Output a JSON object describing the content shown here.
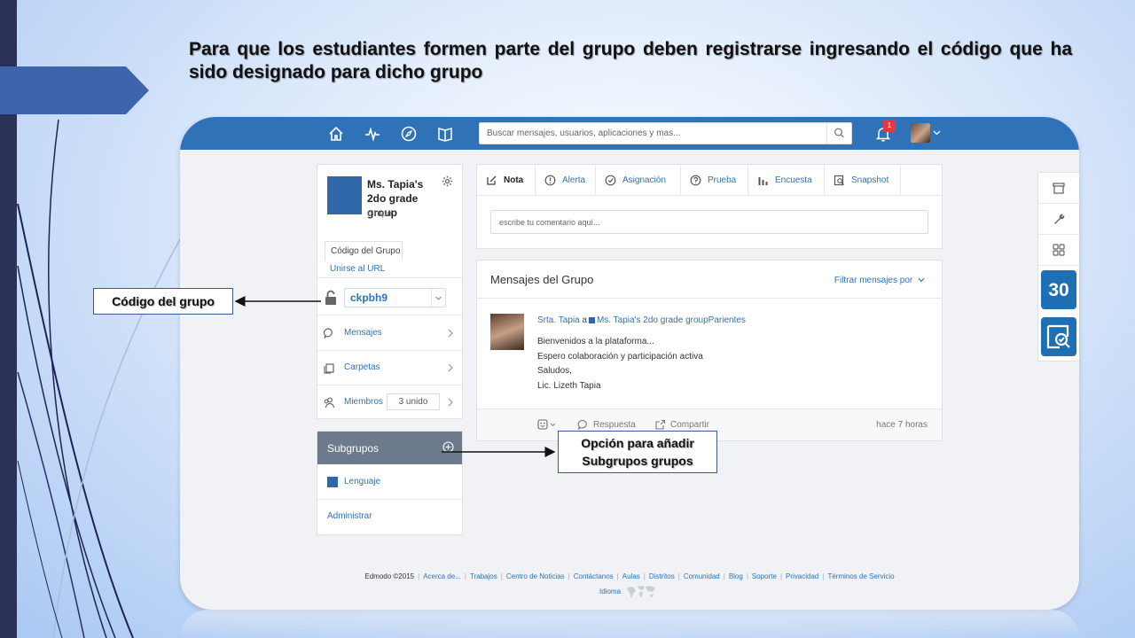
{
  "slide": {
    "title": "Para que los estudiantes formen parte del grupo deben registrarse ingresando el código que ha sido designado para dicho grupo",
    "callout_code": "Código del grupo",
    "callout_sub_line1": "Opción para añadir",
    "callout_sub_line2": "Subgrupos grupos"
  },
  "topbar": {
    "search_placeholder": "Buscar mensajes, usuarios, aplicaciones y mas...",
    "notification_count": "1",
    "icons": [
      "home-icon",
      "activity-icon",
      "compass-icon",
      "book-icon",
      "search-icon",
      "bell-icon"
    ]
  },
  "group": {
    "name": "Ms. Tapia's 2do grade group",
    "type": "Grupo",
    "tab_code": "Código del Grupo",
    "tab_url": "Unirse al URL",
    "code": "ckpbh9",
    "menu": [
      {
        "label": "Mensajes",
        "icon": "chat-icon"
      },
      {
        "label": "Carpetas",
        "icon": "folders-icon"
      },
      {
        "label": "Miembros",
        "icon": "members-icon",
        "count": "3 unido"
      }
    ]
  },
  "subgroups": {
    "title": "Subgrupos",
    "items": [
      "Lenguaje"
    ],
    "admin": "Administrar"
  },
  "composer": {
    "tabs": [
      {
        "label": "Nota",
        "icon": "note-icon",
        "active": true
      },
      {
        "label": "Alerta",
        "icon": "alert-icon"
      },
      {
        "label": "Asignación",
        "icon": "assignment-icon"
      },
      {
        "label": "Prueba",
        "icon": "quiz-icon"
      },
      {
        "label": "Encuesta",
        "icon": "poll-icon"
      },
      {
        "label": "Snapshot",
        "icon": "snapshot-icon"
      }
    ],
    "comment_placeholder": "escribe tu comentario aquí..."
  },
  "messages": {
    "title": "Mensajes del Grupo",
    "filter": "Filtrar mensajes por",
    "post": {
      "author": "Srta. Tapia",
      "connector": "a",
      "target": "Ms. Tapia's 2do grade groupParientes",
      "lines": [
        "Bienvenidos a la plataforma...",
        "Espero colaboración y participación activa",
        "Saludos,",
        "Lic. Lizeth Tapia"
      ],
      "reply": "Respuesta",
      "share": "Compartir",
      "time": "hace 7 horas"
    }
  },
  "apps": {
    "calendar_number": "30",
    "icons": [
      "store-icon",
      "wrench-icon",
      "apps-grid-icon",
      "calendar-icon",
      "check-search-icon"
    ]
  },
  "footer": {
    "copyright": "Edmodo ©2015",
    "links": [
      "Acerca de...",
      "Trabajos",
      "Centro de Noticias",
      "Contáctanos",
      "Aulas",
      "Distritos",
      "Comunidad",
      "Blog",
      "Soporte",
      "Privacidad",
      "Términos de Servicio"
    ],
    "language": "Idioma"
  },
  "colors": {
    "edmodo_blue": "#2f72b8",
    "subgroup_header": "#6d7a8c",
    "badge_red": "#e8373f",
    "slide_strip": "#2a3257"
  }
}
